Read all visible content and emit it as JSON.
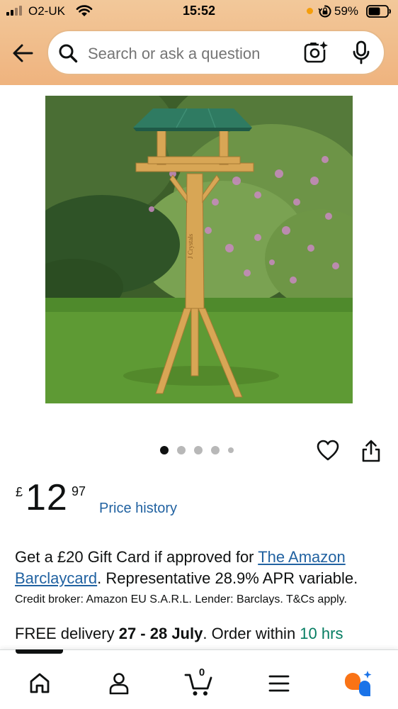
{
  "status_bar": {
    "carrier": "O2-UK",
    "time": "15:52",
    "battery_percent": "59%",
    "signal_bars": 4,
    "signal_bars_filled": 2,
    "icons": [
      "signal-icon",
      "wifi-icon",
      "orange-dot-indicator",
      "rotation-lock-icon",
      "battery-icon"
    ]
  },
  "header": {
    "search_placeholder": "Search or ask a question",
    "icons": [
      "back-arrow-icon",
      "search-icon",
      "camera-search-icon",
      "microphone-icon"
    ],
    "colors": {
      "header_bg": "#efb37e",
      "search_border": "#e7b989"
    }
  },
  "product": {
    "image_subject": "wooden bird table with green roof on lawn",
    "image_watermark": "J Crystals",
    "carousel": {
      "count": 5,
      "active_index": 0
    },
    "price": {
      "currency": "£",
      "whole": "12",
      "fraction": "97"
    },
    "price_history_link": "Price history",
    "offer": {
      "prefix": "Get a £20 Gift Card if approved for ",
      "link": "The Amazon Barclaycard",
      "suffix": ". Representative 28.9% APR variable."
    },
    "credit_note": "Credit broker: Amazon EU S.A.R.L. Lender: Barclays. T&Cs apply.",
    "delivery": {
      "prefix": "FREE delivery ",
      "dates": "27 - 28 July",
      "middle": ". Order within ",
      "time_left": "10 hrs"
    }
  },
  "bottom_nav": {
    "cart_count": "0",
    "active_index": 0,
    "items": [
      "home-icon",
      "account-icon",
      "cart-icon",
      "menu-icon",
      "rufus-assistant-icon"
    ]
  },
  "colors": {
    "link": "#2162a1",
    "success": "#067d62",
    "text": "#0f1111",
    "rufus_orange": "#f97316",
    "rufus_blue": "#1a73e8"
  }
}
